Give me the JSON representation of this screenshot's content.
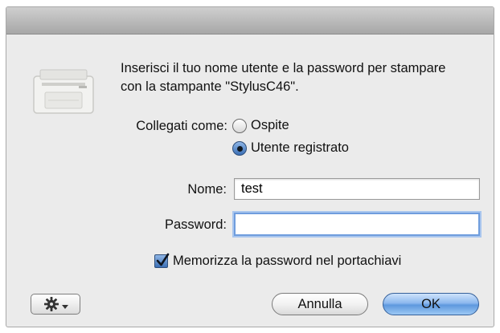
{
  "dialog": {
    "message": "Inserisci il tuo nome utente e la password per stampare con la stampante \"StylusC46\".",
    "connect_as_label": "Collegati come:",
    "options": [
      {
        "label": "Ospite",
        "selected": false
      },
      {
        "label": "Utente registrato",
        "selected": true
      }
    ],
    "name_label": "Nome:",
    "name_value": "test",
    "password_label": "Password:",
    "password_value": "",
    "remember_label": "Memorizza la password nel portachiavi",
    "remember_checked": true,
    "cancel_label": "Annulla",
    "ok_label": "OK"
  },
  "icons": {
    "printer": "printer-icon",
    "gear": "gear-icon",
    "menu_arrow": "chevron-down-icon"
  },
  "colors": {
    "window_bg": "#ebebeb",
    "accent": "#5e98de",
    "focus_ring": "#6f9ddd"
  }
}
